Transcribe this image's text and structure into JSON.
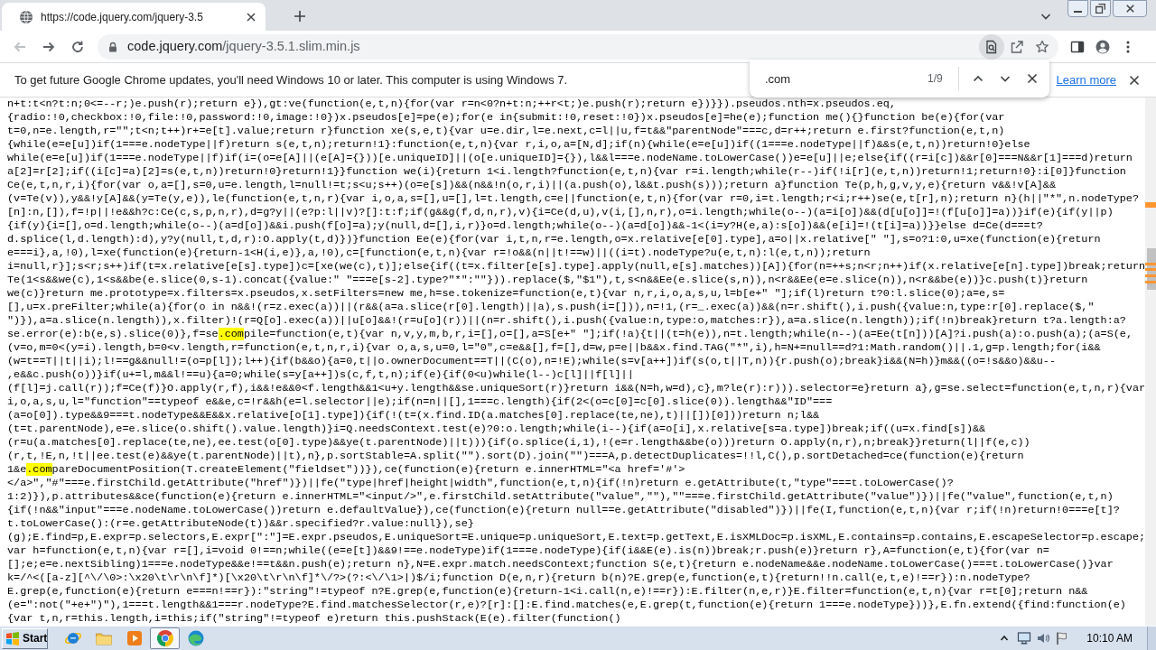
{
  "browser": {
    "tabs": [
      {
        "title": "https://code.jquery.com/jquery-3.5",
        "selected": true
      }
    ],
    "nav_buttons": [
      {
        "kind": "back",
        "disabled": true
      },
      {
        "kind": "forward",
        "disabled": false
      },
      {
        "kind": "reload",
        "disabled": false
      }
    ],
    "address_bar": {
      "host": "code.jquery.com",
      "path": "/jquery-3.5.1.slim.min.js"
    }
  },
  "infobar": {
    "message": "To get future Google Chrome updates, you'll need Windows 10 or later. This computer is using Windows 7.",
    "link": "Learn more"
  },
  "find_bar": {
    "query": ".com",
    "count": "1/9"
  },
  "code_lines": [
    {
      "parts": [
        {
          "text": "n+t:t<n?t:n;0<=--r;)e.push(r);return e}),gt:ve(function(e,t,n){for(var r=n<0?n+t:n;++r<t;)e.push(r);return e})}}).pseudos.nth=x.pseudos.eq,",
          "highlighted": false
        }
      ]
    },
    {
      "parts": [
        {
          "text": "{radio:!0,checkbox:!0,file:!0,password:!0,image:!0})x.pseudos[e]=pe(e);for(e in{submit:!0,reset:!0})x.pseudos[e]=he(e);function me(){}function be(e){for(var",
          "highlighted": false
        }
      ]
    },
    {
      "parts": [
        {
          "text": "t=0,n=e.length,r=\"\";t<n;t++)r+=e[t].value;return r}function xe(s,e,t){var u=e.dir,l=e.next,c=l||u,f=t&&\"parentNode\"===c,d=r++;return e.first?function(e,t,n)",
          "highlighted": false
        }
      ]
    },
    {
      "parts": [
        {
          "text": "{while(e=e[u])if(1===e.nodeType||f)return s(e,t,n);return!1}:function(e,t,n){var r,i,o,a=[N,d];if(n){while(e=e[u])if((1===e.nodeType||f)&&s(e,t,n))return!0}else",
          "highlighted": false
        }
      ]
    },
    {
      "parts": [
        {
          "text": "while(e=e[u])if(1===e.nodeType||f)if(i=(o=e[A]||(e[A]={}))[e.uniqueID]||(o[e.uniqueID]={}),l&&l===e.nodeName.toLowerCase())e=e[u]||e;else{if((r=i[c])&&r[0]===N&&r[1]===d)return",
          "highlighted": false
        }
      ]
    },
    {
      "parts": [
        {
          "text": "a[2]=r[2];if((i[c]=a)[2]=s(e,t,n))return!0}return!1}}function we(i){return 1<i.length?function(e,t,n){var r=i.length;while(r--)if(!i[r](e,t,n))return!1;return!0}:i[0]}function",
          "highlighted": false
        }
      ]
    },
    {
      "parts": [
        {
          "text": "Ce(e,t,n,r,i){for(var o,a=[],s=0,u=e.length,l=null!=t;s<u;s++)(o=e[s])&&(n&&!n(o,r,i)||(a.push(o),l&&t.push(s)));return a}function Te(p,h,g,v,y,e){return v&&!v[A]&&",
          "highlighted": false
        }
      ]
    },
    {
      "parts": [
        {
          "text": "(v=Te(v)),y&&!y[A]&&(y=Te(y,e)),le(function(e,t,n,r){var i,o,a,s=[],u=[],l=t.length,c=e||function(e,t,n){for(var r=0,i=t.length;r<i;r++)se(e,t[r],n);return n}(h||\"*\",n.nodeType?",
          "highlighted": false
        }
      ]
    },
    {
      "parts": [
        {
          "text": "[n]:n,[]),f=!p||!e&&h?c:Ce(c,s,p,n,r),d=g?y||(e?p:l||v)?[]:t:f;if(g&&g(f,d,n,r),v){i=Ce(d,u),v(i,[],n,r),o=i.length;while(o--)(a=i[o])&&(d[u[o]]=!(f[u[o]]=a))}if(e){if(y||p)",
          "highlighted": false
        }
      ]
    },
    {
      "parts": [
        {
          "text": "{if(y){i=[],o=d.length;while(o--)(a=d[o])&&i.push(f[o]=a);y(null,d=[],i,r)}o=d.length;while(o--)(a=d[o])&&-1<(i=y?H(e,a):s[o])&&(e[i]=!(t[i]=a))}}else d=Ce(d===t?",
          "highlighted": false
        }
      ]
    },
    {
      "parts": [
        {
          "text": "d.splice(l,d.length):d),y?y(null,t,d,r):O.apply(t,d)})}function Ee(e){for(var i,t,n,r=e.length,o=x.relative[e[0].type],a=o||x.relative[\" \"],s=o?1:0,u=xe(function(e){return",
          "highlighted": false
        }
      ]
    },
    {
      "parts": [
        {
          "text": "e===i},a,!0),l=xe(function(e){return-1<H(i,e)},a,!0),c=[function(e,t,n){var r=!o&&(n||t!==w)||((i=t).nodeType?u(e,t,n):l(e,t,n));return",
          "highlighted": false
        }
      ]
    },
    {
      "parts": [
        {
          "text": "i=null,r}];s<r;s++)if(t=x.relative[e[s].type])c=[xe(we(c),t)];else{if((t=x.filter[e[s].type].apply(null,e[s].matches))[A]){for(n=++s;n<r;n++)if(x.relative[e[n].type])break;return",
          "highlighted": false
        }
      ]
    },
    {
      "parts": [
        {
          "text": "Te(1<s&&we(c),1<s&&be(e.slice(0,s-1).concat({value:\" \"===e[s-2].type?\"*\":\"\"})).replace($,\"$1\"),t,s<n&&Ee(e.slice(s,n)),n<r&&Ee(e=e.slice(n)),n<r&&be(e))}c.push(t)}return",
          "highlighted": false
        }
      ]
    },
    {
      "parts": [
        {
          "text": "we(c)}return me.prototype=x.filters=x.pseudos,x.setFilters=new me,h=se.tokenize=function(e,t){var n,r,i,o,a,s,u,l=b[e+\" \"];if(l)return t?0:l.slice(0);a=e,s=",
          "highlighted": false
        }
      ]
    },
    {
      "parts": [
        {
          "text": "[],u=x.preFilter;while(a){for(o in n&&!(r=z.exec(a))||(r&&(a=a.slice(r[0].length)||a),s.push(i=[])),n=!1,(r=_.exec(a))&&(n=r.shift(),i.push({value:n,type:r[0].replace($,\"",
          "highlighted": false
        }
      ]
    },
    {
      "parts": [
        {
          "text": "\")}),a=a.slice(n.length)),x.filter)!(r=Q[o].exec(a))||u[o]&&!(r=u[o](r))||(n=r.shift(),i.push({value:n,type:o,matches:r}),a=a.slice(n.length));if(!n)break}return t?a.length:a?",
          "highlighted": false
        }
      ]
    },
    {
      "parts": [
        {
          "text": "se.error(e):b(e,s).slice(0)},f=se",
          "highlighted": false
        },
        {
          "text": ".com",
          "highlighted": true
        },
        {
          "text": "pile=function(e,t){var n,v,y,m,b,r,i=[],o=[],a=S[e+\" \"];if(!a){t||(t=h(e)),n=t.length;while(n--)(a=Ee(t[n]))[A]?i.push(a):o.push(a);(a=S(e,",
          "highlighted": false
        }
      ]
    },
    {
      "parts": [
        {
          "text": "(v=o,m=0<(y=i).length,b=0<v.length,r=function(e,t,n,r,i){var o,a,s,u=0,l=\"0\",c=e&&[],f=[],d=w,p=e||b&&x.find.TAG(\"*\",i),h=N+=null==d?1:Math.random()||.1,g=p.length;for(i&&",
          "highlighted": false
        }
      ]
    },
    {
      "parts": [
        {
          "text": "(w=t==T||t||i);l!==g&&null!=(o=p[l]);l++){if(b&&o){a=0,t||o.ownerDocument==T||(C(o),n=!E);while(s=v[a++])if(s(o,t||T,n)){r.push(o);break}i&&(N=h)}m&&((o=!s&&o)&&u--",
          "highlighted": false
        }
      ]
    },
    {
      "parts": [
        {
          "text": ",e&&c.push(o))}if(u+=l,m&&l!==u){a=0;while(s=y[a++])s(c,f,t,n);if(e){if(0<u)while(l--)c[l]||f[l]||",
          "highlighted": false
        }
      ]
    },
    {
      "parts": [
        {
          "text": "(f[l]=j.call(r));f=Ce(f)}O.apply(r,f),i&&!e&&0<f.length&&1<u+y.length&&se.uniqueSort(r)}return i&&(N=h,w=d),c},m?le(r):r))).selector=e}return a},g=se.select=function(e,t,n,r){var",
          "highlighted": false
        }
      ]
    },
    {
      "parts": [
        {
          "text": "i,o,a,s,u,l=\"function\"==typeof e&&e,c=!r&&h(e=l.selector||e);if(n=n||[],1===c.length){if(2<(o=c[0]=c[0].slice(0)).length&&\"ID\"===",
          "highlighted": false
        }
      ]
    },
    {
      "parts": [
        {
          "text": "(a=o[0]).type&&9===t.nodeType&&E&&x.relative[o[1].type]){if(!(t=(x.find.ID(a.matches[0].replace(te,ne),t)||[])[0]))return n;l&&",
          "highlighted": false
        }
      ]
    },
    {
      "parts": [
        {
          "text": "(t=t.parentNode),e=e.slice(o.shift().value.length)}i=Q.needsContext.test(e)?0:o.length;while(i--){if(a=o[i],x.relative[s=a.type])break;if((u=x.find[s])&&",
          "highlighted": false
        }
      ]
    },
    {
      "parts": [
        {
          "text": "(r=u(a.matches[0].replace(te,ne),ee.test(o[0].type)&&ye(t.parentNode)||t))){if(o.splice(i,1),!(e=r.length&&be(o)))return O.apply(n,r),n;break}}return(l||f(e,c))",
          "highlighted": false
        }
      ]
    },
    {
      "parts": [
        {
          "text": "(r,t,!E,n,!t||ee.test(e)&&ye(t.parentNode)||t),n},p.sortStable=A.split(\"\").sort(D).join(\"\")===A,p.detectDuplicates=!!l,C(),p.sortDetached=ce(function(e){return",
          "highlighted": false
        }
      ]
    },
    {
      "parts": [
        {
          "text": "1&e",
          "highlighted": false
        },
        {
          "text": ".com",
          "highlighted": true
        },
        {
          "text": "pareDocumentPosition(T.createElement(\"fieldset\"))}),ce(function(e){return e.innerHTML=\"<a href='#'>",
          "highlighted": false
        }
      ]
    },
    {
      "parts": [
        {
          "text": "</a>\",\"#\"===e.firstChild.getAttribute(\"href\")})||fe(\"type|href|height|width\",function(e,t,n){if(!n)return e.getAttribute(t,\"type\"===t.toLowerCase()?",
          "highlighted": false
        }
      ]
    },
    {
      "parts": [
        {
          "text": "1:2)}),p.attributes&&ce(function(e){return e.innerHTML=\"<input/>\",e.firstChild.setAttribute(\"value\",\"\"),\"\"===e.firstChild.getAttribute(\"value\")})||fe(\"value\",function(e,t,n)",
          "highlighted": false
        }
      ]
    },
    {
      "parts": [
        {
          "text": "{if(!n&&\"input\"===e.nodeName.toLowerCase())return e.defaultValue}),ce(function(e){return null==e.getAttribute(\"disabled\")})||fe(I,function(e,t,n){var r;if(!n)return!0===e[t]?",
          "highlighted": false
        }
      ]
    },
    {
      "parts": [
        {
          "text": "t.toLowerCase():(r=e.getAttributeNode(t))&&r.specified?r.value:null}),se}",
          "highlighted": false
        }
      ]
    },
    {
      "parts": [
        {
          "text": "(g);E.find=p,E.expr=p.selectors,E.expr[\":\"]=E.expr.pseudos,E.uniqueSort=E.unique=p.uniqueSort,E.text=p.getText,E.isXMLDoc=p.isXML,E.contains=p.contains,E.escapeSelector=p.escape;",
          "highlighted": false
        }
      ]
    },
    {
      "parts": [
        {
          "text": "var h=function(e,t,n){var r=[],i=void 0!==n;while((e=e[t])&&9!==e.nodeType)if(1===e.nodeType){if(i&&E(e).is(n))break;r.push(e)}return r},A=function(e,t){for(var n=",
          "highlighted": false
        }
      ]
    },
    {
      "parts": [
        {
          "text": "[];e;e=e.nextSibling)1===e.nodeType&&e!==t&&n.push(e);return n},N=E.expr.match.needsContext;function S(e,t){return e.nodeName&&e.nodeName.toLowerCase()===t.toLowerCase()}var",
          "highlighted": false
        }
      ]
    },
    {
      "parts": [
        {
          "text": "k=/^<([a-z][^\\/\\0>:\\x20\\t\\r\\n\\f]*)[\\x20\\t\\r\\n\\f]*\\/?>(?:<\\/\\1>|)$/i;function D(e,n,r){return b(n)?E.grep(e,function(e,t){return!!n.call(e,t,e)!==r}):n.nodeType?",
          "highlighted": false
        }
      ]
    },
    {
      "parts": [
        {
          "text": "E.grep(e,function(e){return e===n!==r}):\"string\"!=typeof n?E.grep(e,function(e){return-1<i.call(n,e)!==r}):E.filter(n,e,r)}E.filter=function(e,t,n){var r=t[0];return n&&",
          "highlighted": false
        }
      ]
    },
    {
      "parts": [
        {
          "text": "(e=\":not(\"+e+\")\"),1===t.length&&1===r.nodeType?E.find.matchesSelector(r,e)?[r]:[]:E.find.matches(e,E.grep(t,function(e){return 1===e.nodeType}))},E.fn.extend({find:function(e)",
          "highlighted": false
        }
      ]
    },
    {
      "parts": [
        {
          "text": "{var t,n,r=this.length,i=this;if(\"string\"!=typeof e)return this.pushStack(E(e).filter(function()",
          "highlighted": false
        }
      ]
    }
  ],
  "taskbar": {
    "start": "Start",
    "apps": [
      {
        "kind": "ringed_e",
        "selected": false
      },
      {
        "kind": "folder",
        "selected": false
      },
      {
        "kind": "player",
        "selected": false
      },
      {
        "kind": "wheel",
        "selected": true
      },
      {
        "kind": "wave",
        "selected": false
      }
    ],
    "clock": "10:10 AM"
  }
}
